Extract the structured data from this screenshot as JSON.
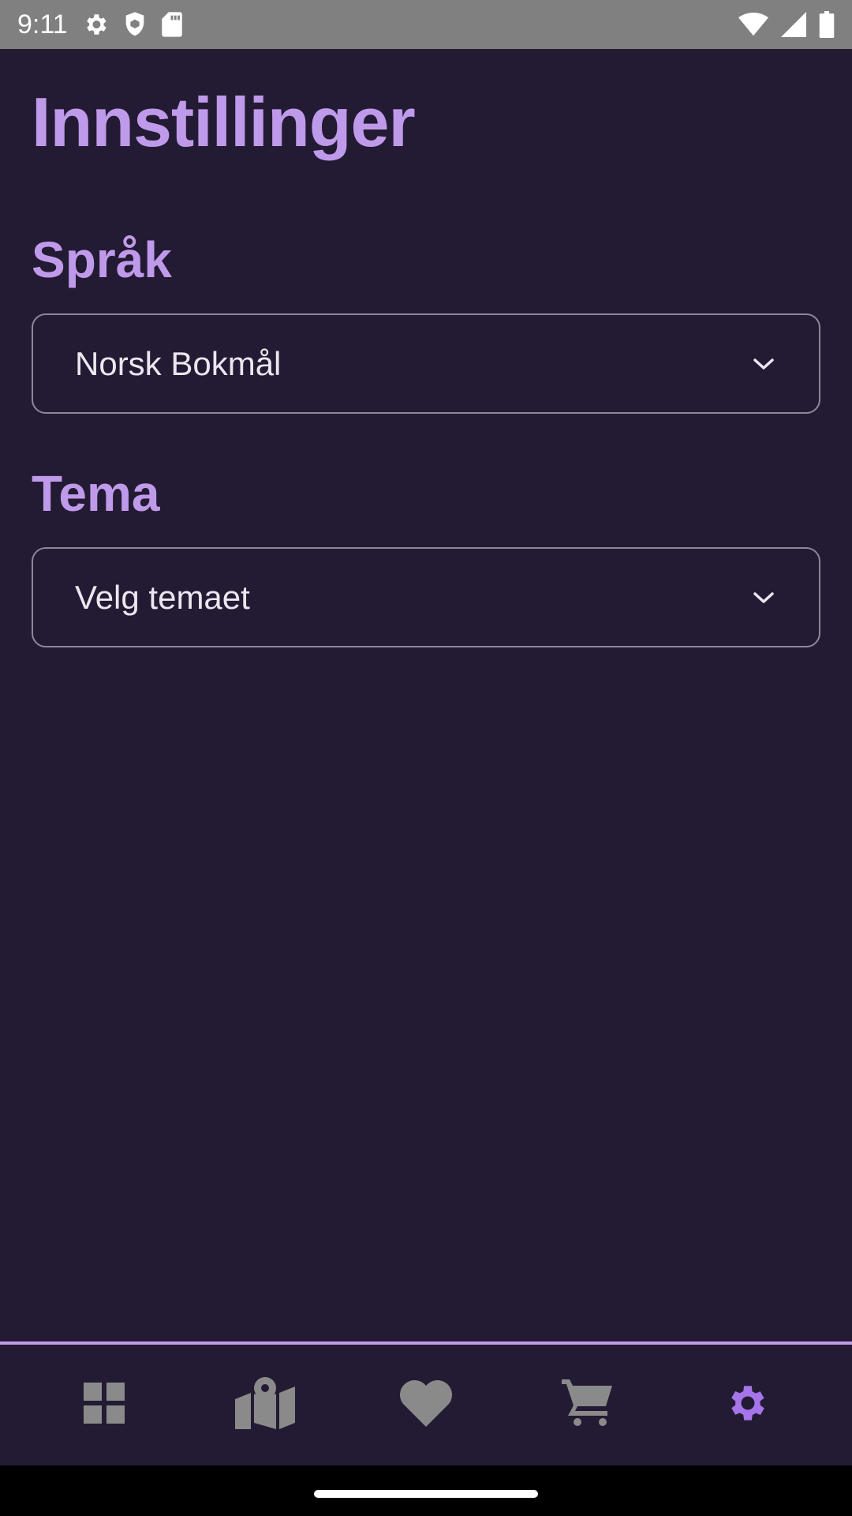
{
  "status_bar": {
    "time": "9:11",
    "left_icons": [
      "settings-gear-icon",
      "shield-icon",
      "sd-card-icon"
    ],
    "right_icons": [
      "wifi-icon",
      "cellular-signal-icon",
      "battery-icon"
    ]
  },
  "page": {
    "title": "Innstillinger"
  },
  "language": {
    "heading": "Språk",
    "selected": "Norsk Bokmål"
  },
  "theme": {
    "heading": "Tema",
    "selected": "Velg temaet"
  },
  "bottom_nav": {
    "items": [
      {
        "icon": "dashboard-grid-icon",
        "active": false
      },
      {
        "icon": "map-pin-icon",
        "active": false
      },
      {
        "icon": "heart-icon",
        "active": false
      },
      {
        "icon": "cart-icon",
        "active": false
      },
      {
        "icon": "gear-icon",
        "active": true
      }
    ],
    "inactive_color": "#8A8A8A",
    "active_color": "#A575E9"
  },
  "colors": {
    "background": "#231B33",
    "accent": "#C09AEA",
    "status_bar": "#808080",
    "field_border": "#8E8797",
    "field_text": "#ECE6F0"
  }
}
